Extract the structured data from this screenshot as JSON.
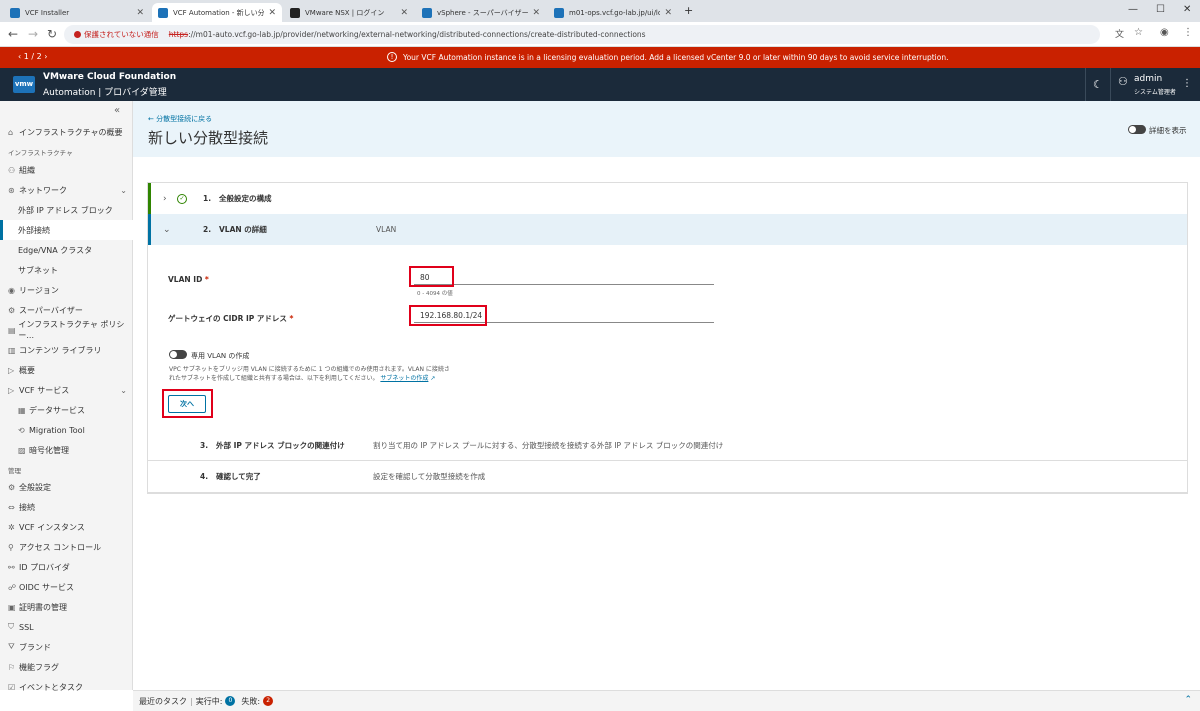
{
  "browser": {
    "tabs": [
      {
        "title": "VCF Installer",
        "color": "#1d72b8"
      },
      {
        "title": "VCF Automation - 新しい分散型接",
        "color": "#1d72b8",
        "active": true
      },
      {
        "title": "VMware NSX | ログイン",
        "color": "#222222"
      },
      {
        "title": "vSphere - スーパーバイザー",
        "color": "#1d72b8"
      },
      {
        "title": "m01-ops.vcf.go-lab.jp/ui/login",
        "color": "#1d72b8"
      }
    ],
    "new_tab": "+",
    "security_label": "保護されていない通信",
    "url_scheme": "https",
    "url_rest": "://m01-auto.vcf.go-lab.jp/provider/networking/external-networking/distributed-connections/create-distributed-connections"
  },
  "banner": {
    "pager": "‹  1 / 2  ›",
    "message": "Your VCF Automation instance is in a licensing evaluation period. Add a licensed vCenter 9.0 or later within 90 days to avoid service interruption."
  },
  "header": {
    "logo": "vmw",
    "brand_line1": "VMware Cloud Foundation",
    "brand_line2": "Automation | プロバイダ管理",
    "user_name": "admin",
    "user_role": "システム管理者"
  },
  "sidebar": {
    "items": [
      {
        "label": "インフラストラクチャの概要",
        "icon": "⌂"
      },
      {
        "label": "組織",
        "icon": "⚇"
      },
      {
        "label": "ネットワーク",
        "icon": "⊛"
      },
      {
        "label": "外部 IP アドレス ブロック"
      },
      {
        "label": "外部接続"
      },
      {
        "label": "Edge/VNA クラスタ"
      },
      {
        "label": "サブネット"
      },
      {
        "label": "リージョン",
        "icon": "◉"
      },
      {
        "label": "スーパーバイザー",
        "icon": "⚙"
      },
      {
        "label": "インフラストラクチャ ポリシー...",
        "icon": "▤"
      },
      {
        "label": "コンテンツ ライブラリ",
        "icon": "▥"
      },
      {
        "label": "概要",
        "icon": "▷"
      },
      {
        "label": "VCF サービス",
        "icon": "▷"
      },
      {
        "label": "データサービス",
        "icon": "▦"
      },
      {
        "label": "Migration Tool",
        "icon": "⟲"
      },
      {
        "label": "暗号化管理",
        "icon": "▨"
      },
      {
        "label": "全般設定",
        "icon": "⚙"
      },
      {
        "label": "接続",
        "icon": "⇔"
      },
      {
        "label": "VCF インスタンス",
        "icon": "✲"
      },
      {
        "label": "アクセス コントロール",
        "icon": "⚲"
      },
      {
        "label": "ID プロバイダ",
        "icon": "⚯"
      },
      {
        "label": "OIDC サービス",
        "icon": "☍"
      },
      {
        "label": "証明書の管理",
        "icon": "▣"
      },
      {
        "label": "SSL",
        "icon": "⛉"
      },
      {
        "label": "ブランド",
        "icon": "⛛"
      },
      {
        "label": "機能フラグ",
        "icon": "⚐"
      },
      {
        "label": "イベントとタスク",
        "icon": "☑"
      }
    ],
    "section_infra": "インフラストラクチャ",
    "section_admin": "管理"
  },
  "main": {
    "back_link": "← 分散型接続に戻る",
    "title": "新しい分散型接続",
    "details_toggle": "詳細を表示",
    "steps": [
      {
        "num": "1.",
        "title": "全般設定の構成",
        "desc": ""
      },
      {
        "num": "2.",
        "title": "VLAN の詳細",
        "desc": "VLAN"
      },
      {
        "num": "3.",
        "title": "外部 IP アドレス ブロックの関連付け",
        "desc": "割り当て用の IP アドレス プールに対する、分散型接続を接続する外部 IP アドレス ブロックの関連付け"
      },
      {
        "num": "4.",
        "title": "確認して完了",
        "desc": "設定を確認して分散型接続を作成"
      }
    ],
    "form": {
      "vlan_label": "VLAN ID",
      "vlan_value": "80",
      "vlan_hint": "0 - 4094 の値",
      "cidr_label": "ゲートウェイの CIDR IP アドレス",
      "cidr_value": "192.168.80.1/24",
      "required_mark": "*",
      "dedicated_vlan_label": "専用 VLAN の作成",
      "note_line1": "VPC サブネットをブリッジ用 VLAN に接続するために 1 つの組織でのみ使用されます。VLAN に接続さ",
      "note_line2": "れたサブネットを作成して組織と共有する場合は、以下を利用してください。",
      "note_link": "サブネットの作成",
      "next_button": "次へ"
    }
  },
  "footer": {
    "recent_tasks": "最近のタスク",
    "running_label": "実行中:",
    "running_count": "0",
    "failed_label": "失敗:",
    "failed_count": "2"
  }
}
